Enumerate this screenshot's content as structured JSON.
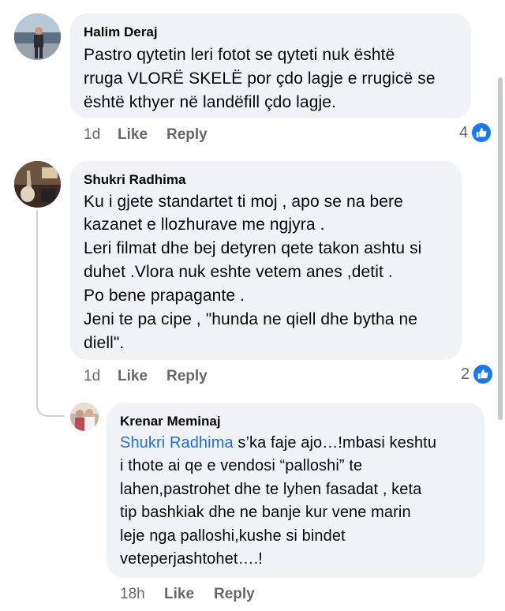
{
  "comments": [
    {
      "author": "Halim Deraj",
      "lines": [
        "Pastro  qytetin  leri fotot se  qyteti nuk është",
        "rruga VLORË SKELË  por çdo lagje e rrugicë se",
        "është kthyer  në landëfill çdo lagje."
      ],
      "time": "1d",
      "like_label": "Like",
      "reply_label": "Reply",
      "reaction_count": "4"
    },
    {
      "author": "Shukri Radhima",
      "lines": [
        "Ku i gjete standartet ti moj , apo se na bere",
        "kazanet e llozhurave me ngjyra .",
        "Leri filmat dhe bej detyren qete takon ashtu si",
        "duhet .Vlora nuk eshte vetem anes ,detit .",
        "Po bene prapagante .",
        "Jeni te pa cipe , \"hunda ne qiell dhe bytha ne",
        "diell\"."
      ],
      "time": "1d",
      "like_label": "Like",
      "reply_label": "Reply",
      "reaction_count": "2"
    }
  ],
  "reply": {
    "author": "Krenar Meminaj",
    "mention": "Shukri Radhima",
    "first_line_rest": " s’ka faje ajo…!mbasi keshtu",
    "lines": [
      "i thote ai qe e vendosi “palloshi” te",
      "lahen,pastrohet dhe te lyhen fasadat , keta",
      "tip bashkiak dhe ne banje kur vene marin",
      "leje nga palloshi,kushe si bindet",
      "veteperjashtohet….!"
    ],
    "time": "18h",
    "like_label": "Like",
    "reply_label": "Reply"
  },
  "icons": {
    "reaction": "like-thumb-icon",
    "accent_color": "#1877f2"
  }
}
